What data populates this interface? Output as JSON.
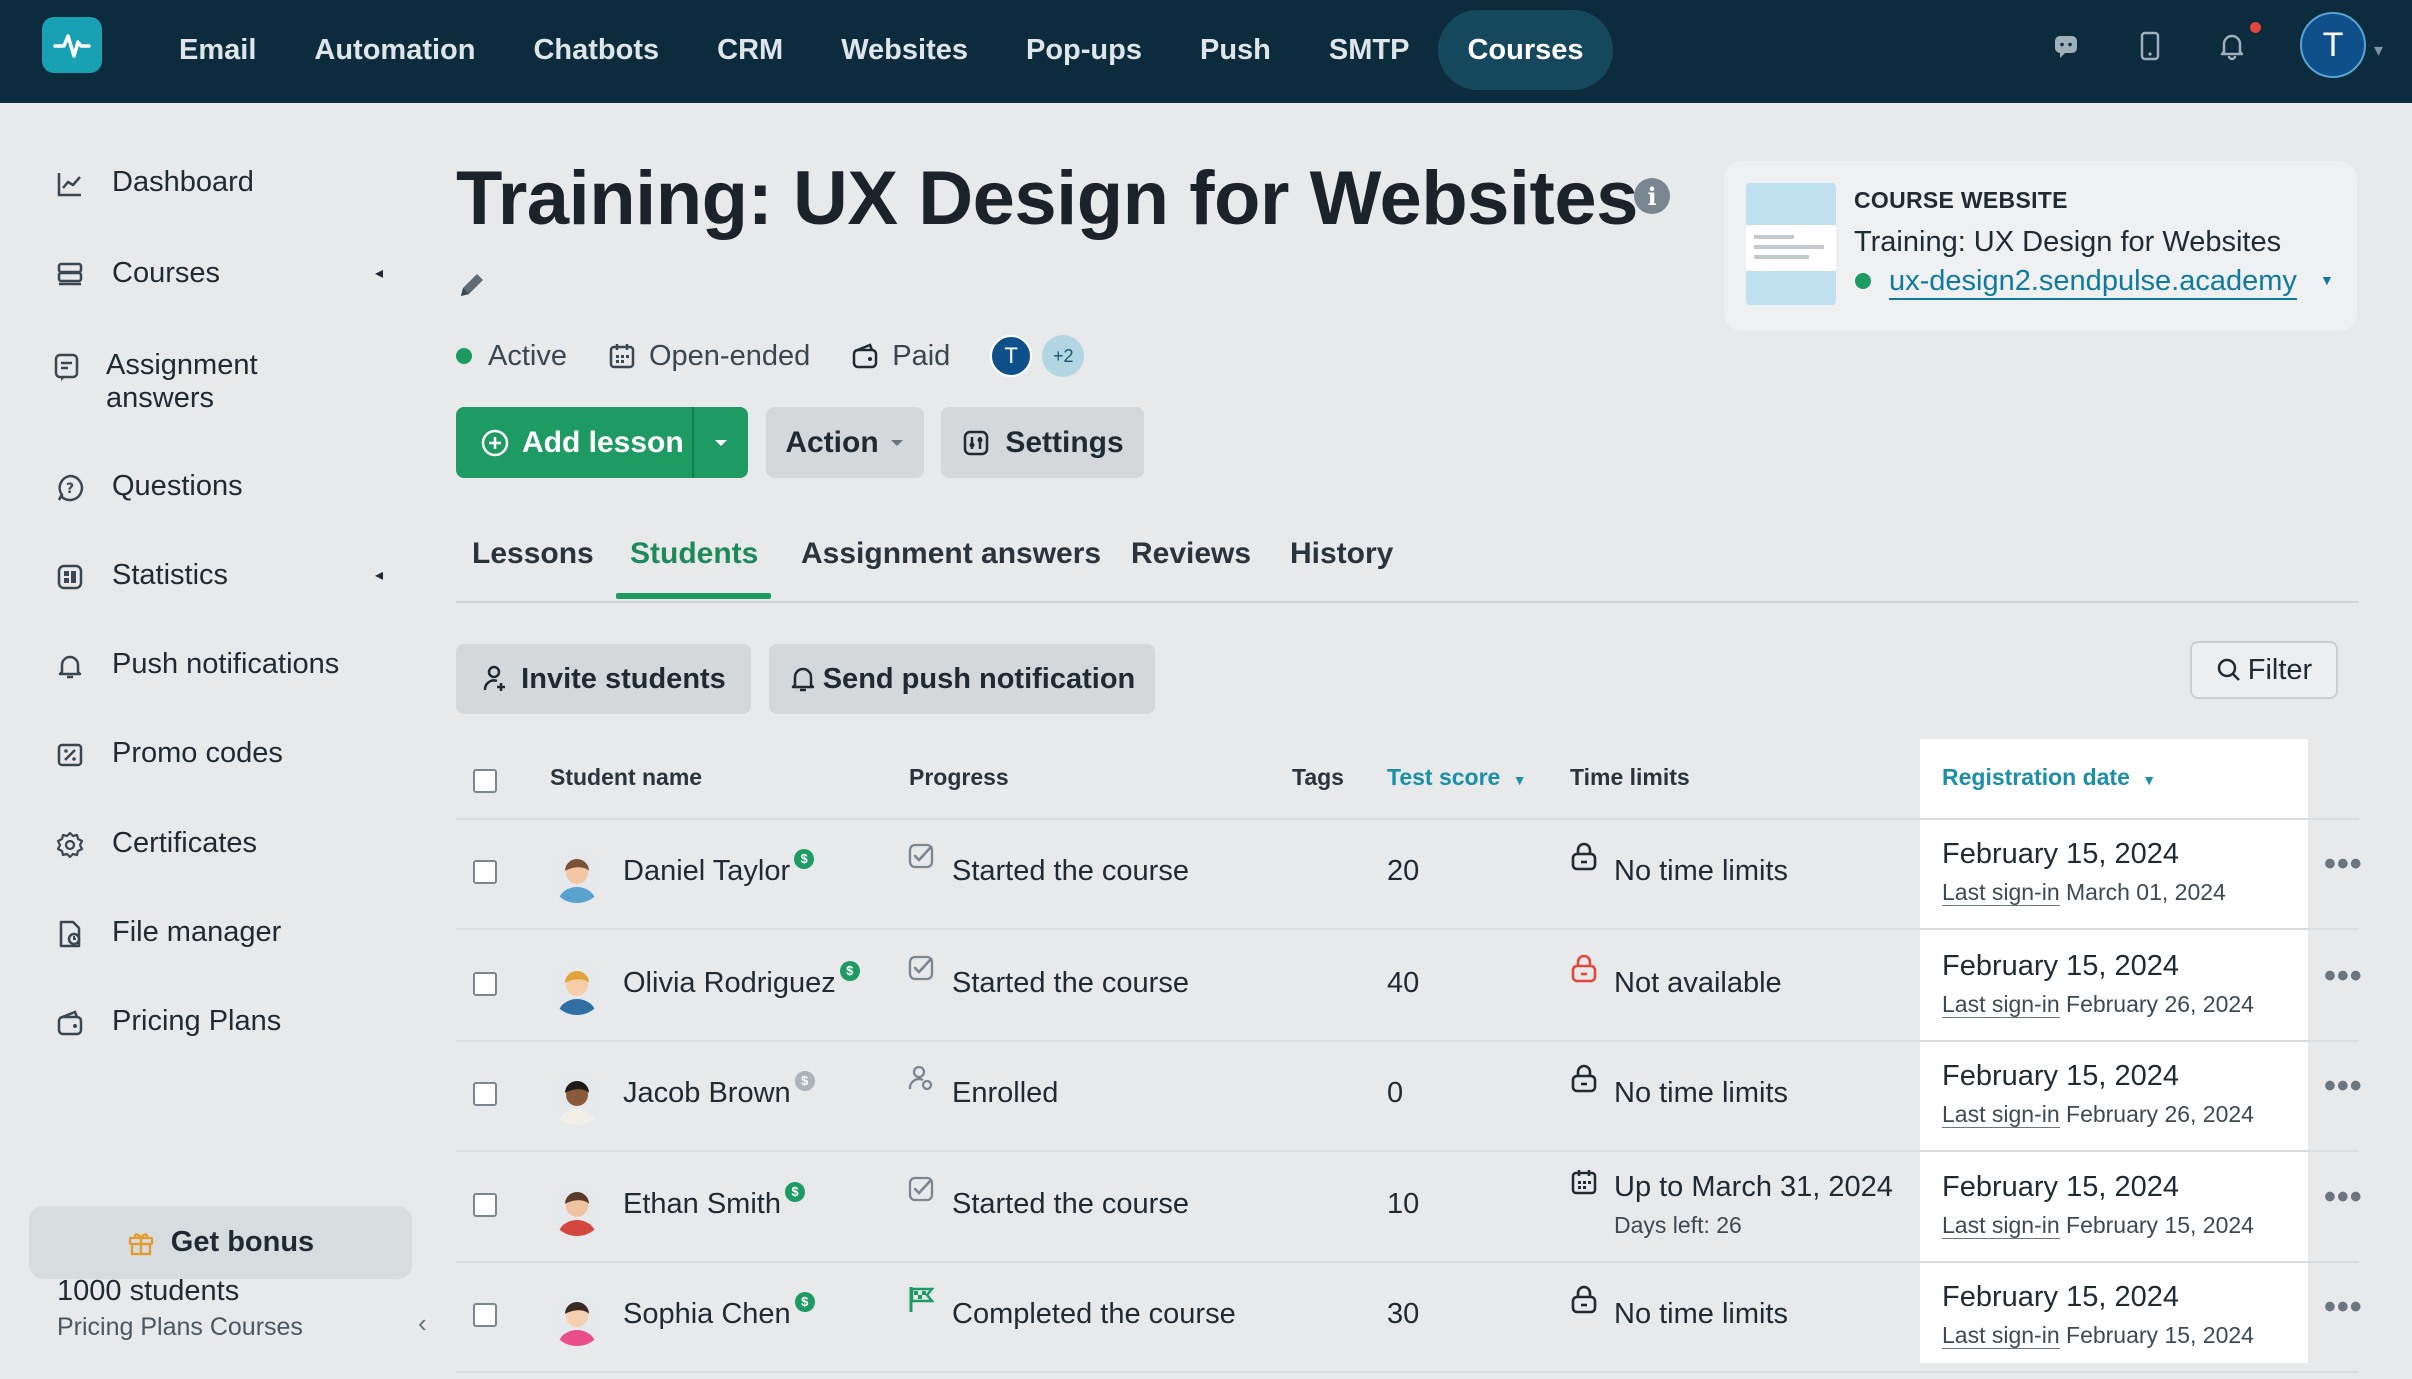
{
  "nav": {
    "items": [
      "Email",
      "Automation",
      "Chatbots",
      "CRM",
      "Websites",
      "Pop-ups",
      "Push",
      "SMTP",
      "Courses"
    ],
    "active": "Courses",
    "avatar_letter": "T"
  },
  "sidebar": {
    "items": [
      {
        "label": "Dashboard",
        "icon": "chart-line-icon"
      },
      {
        "label": "Courses",
        "icon": "stack-icon"
      },
      {
        "label": "Assignment answers",
        "icon": "assignment-icon"
      },
      {
        "label": "Questions",
        "icon": "question-icon"
      },
      {
        "label": "Statistics",
        "icon": "statistics-icon"
      },
      {
        "label": "Push notifications",
        "icon": "bell-icon"
      },
      {
        "label": "Promo codes",
        "icon": "promo-icon"
      },
      {
        "label": "Certificates",
        "icon": "certificate-icon"
      },
      {
        "label": "File manager",
        "icon": "file-manager-icon"
      },
      {
        "label": "Pricing Plans",
        "icon": "wallet-icon"
      }
    ],
    "get_bonus": "Get bonus",
    "students_count": "1000 students",
    "plan_name": "Pricing Plans Courses"
  },
  "course": {
    "title": "Training: UX Design for Websites",
    "status": "Active",
    "duration": "Open-ended",
    "pricing": "Paid",
    "author_avatar": "T",
    "more_authors": "+2"
  },
  "toolbar": {
    "add_lesson": "Add lesson",
    "action": "Action",
    "settings": "Settings"
  },
  "site_card": {
    "label": "COURSE WEBSITE",
    "name": "Training: UX Design for Websites",
    "url": "ux-design2.sendpulse.academy"
  },
  "tabs": [
    "Lessons",
    "Students",
    "Assignment answers",
    "Reviews",
    "History"
  ],
  "active_tab": "Students",
  "actions": {
    "invite": "Invite students",
    "send_push": "Send push notification",
    "filter": "Filter"
  },
  "table": {
    "headers": {
      "name": "Student name",
      "progress": "Progress",
      "tags": "Tags",
      "score": "Test score",
      "limits": "Time limits",
      "registration": "Registration date"
    },
    "last_signin_label": "Last sign-in",
    "rows": [
      {
        "name": "Daniel Taylor",
        "paid": true,
        "progress": "Started the course",
        "progress_icon": "check-square-icon",
        "score": "20",
        "limit": "No time limits",
        "limit_icon": "unlock-icon",
        "limit_sub": "",
        "reg_date": "February 15, 2024",
        "last_signin": "March 01, 2024"
      },
      {
        "name": "Olivia Rodriguez",
        "paid": true,
        "progress": "Started the course",
        "progress_icon": "check-square-icon",
        "score": "40",
        "limit": "Not available",
        "limit_icon": "lock-red-icon",
        "limit_sub": "",
        "reg_date": "February 15, 2024",
        "last_signin": "February 26, 2024"
      },
      {
        "name": "Jacob Brown",
        "paid": false,
        "progress": "Enrolled",
        "progress_icon": "user-enrolled-icon",
        "score": "0",
        "limit": "No time limits",
        "limit_icon": "unlock-icon",
        "limit_sub": "",
        "reg_date": "February 15, 2024",
        "last_signin": "February 26, 2024"
      },
      {
        "name": "Ethan Smith",
        "paid": true,
        "progress": "Started the course",
        "progress_icon": "check-square-icon",
        "score": "10",
        "limit": "Up to March 31, 2024",
        "limit_icon": "calendar-icon",
        "limit_sub": "Days left: 26",
        "reg_date": "February 15, 2024",
        "last_signin": "February 15, 2024"
      },
      {
        "name": "Sophia Chen",
        "paid": true,
        "progress": "Completed the course",
        "progress_icon": "flag-icon",
        "score": "30",
        "limit": "No time limits",
        "limit_icon": "unlock-icon",
        "limit_sub": "",
        "reg_date": "February 15, 2024",
        "last_signin": "February 15, 2024"
      }
    ]
  },
  "colors": {
    "topbar": "#0c2b3d",
    "accent_green": "#1e9b62",
    "link_blue": "#117a9c",
    "sort_blue": "#1a8fa6",
    "danger": "#e3463d"
  }
}
